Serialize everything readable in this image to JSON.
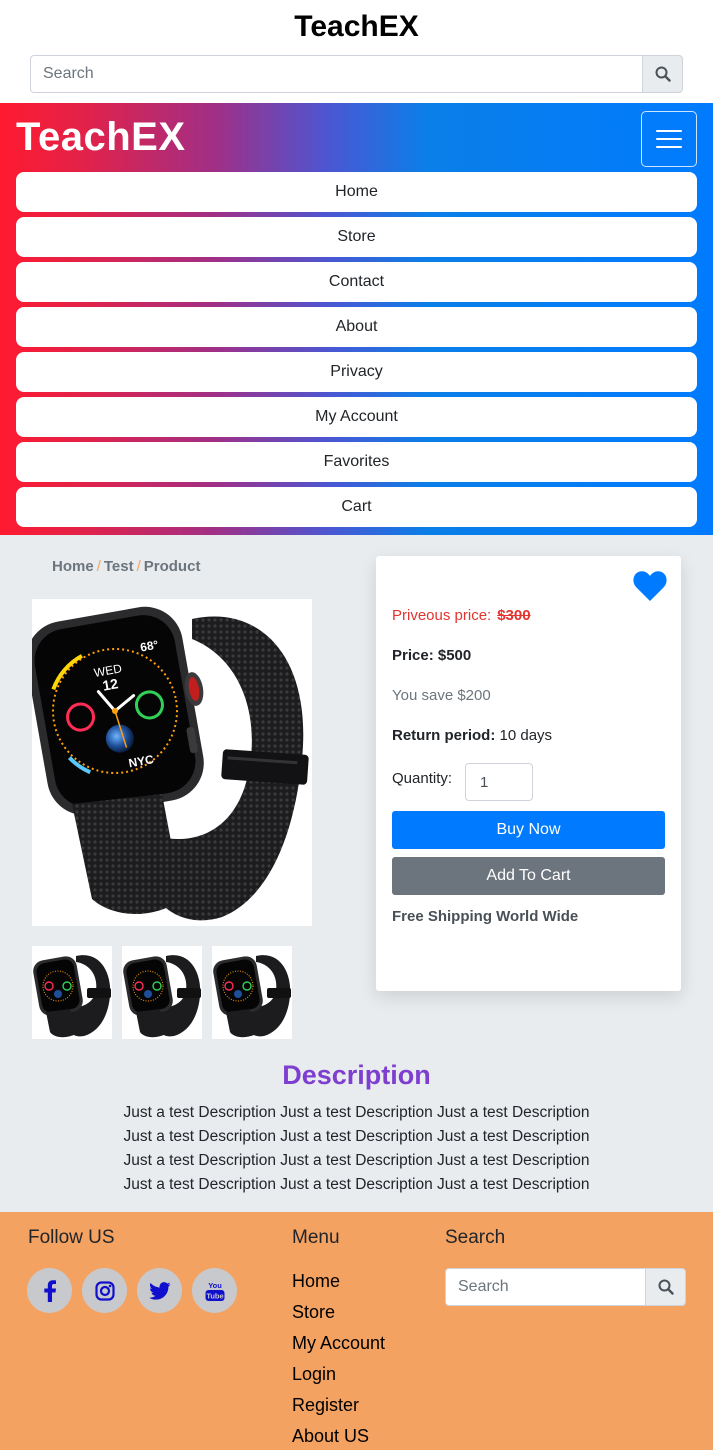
{
  "header": {
    "brand": "TeachEX",
    "search_placeholder": "Search"
  },
  "navbar": {
    "brand": "TeachEX",
    "items": [
      "Home",
      "Store",
      "Contact",
      "About",
      "Privacy",
      "My Account",
      "Favorites",
      "Cart"
    ]
  },
  "breadcrumb": {
    "home": "Home",
    "sep1": "/",
    "test": "Test",
    "sep2": "/",
    "product": "Product"
  },
  "product": {
    "prev_price_label": "Priveous price:",
    "prev_price_value": "$300",
    "price_label": "Price:",
    "price_value": "$500",
    "save_text": "You save $200",
    "return_label": "Return period:",
    "return_value": "10 days",
    "quantity_label": "Quantity:",
    "quantity_value": "1",
    "buy_label": "Buy Now",
    "cart_label": "Add To Cart",
    "shipping": "Free Shipping World Wide",
    "watch_face_time": "12",
    "watch_face_city": "NYC",
    "watch_face_temp": "68°",
    "watch_face_day": "WED"
  },
  "description": {
    "title": "Description",
    "lines": [
      "Just a test Description Just a test Description Just a test Description",
      "Just a test Description Just a test Description Just a test Description",
      "Just a test Description Just a test Description Just a test Description",
      "Just a test Description Just a test Description Just a test Description"
    ]
  },
  "footer": {
    "follow_title": "Follow US",
    "social": [
      "facebook-icon",
      "instagram-icon",
      "twitter-icon",
      "youtube-icon"
    ],
    "youtube_text": "You Tube",
    "menu_title": "Menu",
    "menu_items": [
      "Home",
      "Store",
      "My Account",
      "Login",
      "Register",
      "About US"
    ],
    "search_title": "Search",
    "search_placeholder": "Search"
  },
  "colors": {
    "accent_blue": "#007bff",
    "secondary": "#6c757d",
    "footer_bg": "#f4a261",
    "description_title": "#7e3fd0",
    "previous_price": "#e3342f",
    "social_icon": "#1010cc"
  }
}
